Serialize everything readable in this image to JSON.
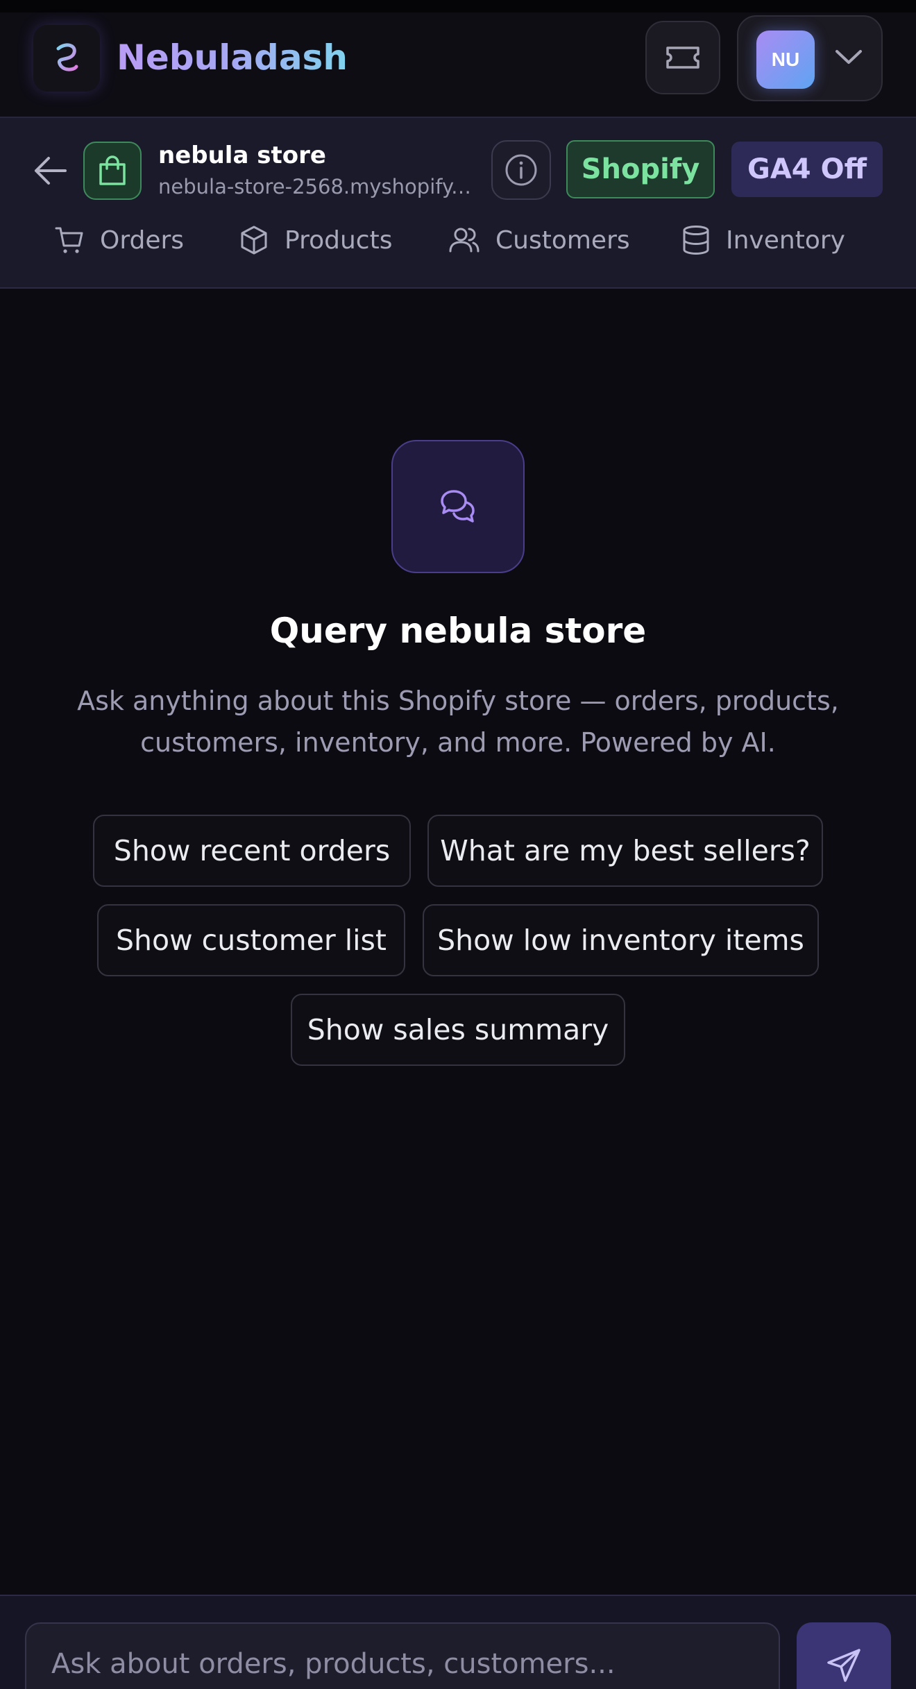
{
  "app": {
    "name": "Nebuladash",
    "avatar_initials": "NU",
    "logo_icon": "swirl-logo-icon",
    "accent": "#a98cf3"
  },
  "store": {
    "name": "nebula store",
    "url": "nebula-store-2568.myshopify.com",
    "platform_badge": "Shopify",
    "ga4_badge": "GA4 Off",
    "platform_color": "#7be2a0"
  },
  "tabs": [
    {
      "label": "Orders",
      "icon": "cart-icon"
    },
    {
      "label": "Products",
      "icon": "box-icon"
    },
    {
      "label": "Customers",
      "icon": "users-icon"
    },
    {
      "label": "Inventory",
      "icon": "database-icon"
    }
  ],
  "main": {
    "title": "Query nebula store",
    "description": "Ask anything about this Shopify store — orders, products, customers, inventory, and more. Powered by AI.",
    "suggestions": [
      "Show recent orders",
      "What are my best sellers?",
      "Show customer list",
      "Show low inventory items",
      "Show sales summary"
    ]
  },
  "composer": {
    "placeholder": "Ask about orders, products, customers..."
  }
}
